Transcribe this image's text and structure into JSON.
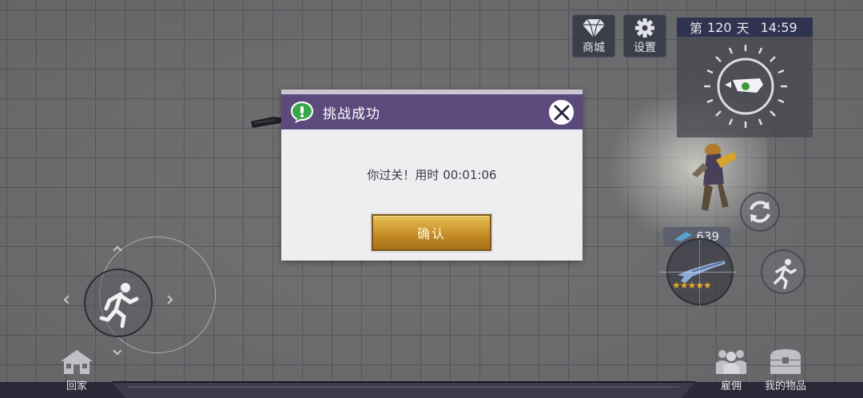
{
  "top_buttons": {
    "shop_label": "商城",
    "settings_label": "设置"
  },
  "minimap": {
    "day_prefix": "第",
    "day_number": "120",
    "day_suffix": "天",
    "time": "14:59"
  },
  "dialog": {
    "title": "挑战成功",
    "message": "你过关！用时 00:01:06",
    "confirm_label": "确认"
  },
  "weapon": {
    "ammo": "639",
    "stars": "★★★★★"
  },
  "bottom": {
    "home_label": "回家",
    "hire_label": "雇佣",
    "inventory_label": "我的物品"
  },
  "colors": {
    "dialog_header": "#5c4a7c",
    "confirm_gold": "#c28a24",
    "star_gold": "#e8a92a"
  },
  "icons": {
    "shop": "diamond-icon",
    "settings": "gear-icon",
    "dialog": "exclamation-speech-icon",
    "close": "close-icon",
    "sprint": "running-man-icon",
    "reload": "reload-icon",
    "home": "house-icon",
    "hire": "people-icon",
    "inventory": "chest-icon"
  }
}
